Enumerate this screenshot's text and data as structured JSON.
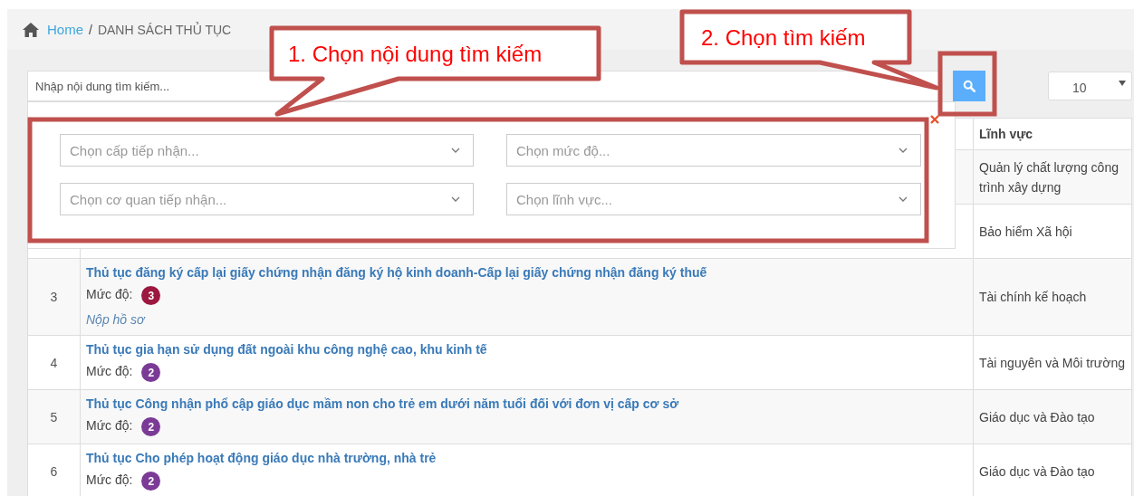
{
  "breadcrumb": {
    "home": "Home",
    "separator": "/",
    "current": "DANH SÁCH THỦ TỤC"
  },
  "search": {
    "placeholder": "Nhập nội dung tìm kiếm..."
  },
  "page_size": {
    "value": "10"
  },
  "filters": [
    {
      "placeholder": "Chọn cấp tiếp nhận..."
    },
    {
      "placeholder": "Chọn mức độ..."
    },
    {
      "placeholder": "Chọn cơ quan tiếp nhận..."
    },
    {
      "placeholder": "Chọn lĩnh vực..."
    }
  ],
  "table": {
    "columns": [
      {
        "label": "Lĩnh vực"
      }
    ],
    "rows": [
      {
        "field": "Quản lý chất lượng công trình xây dựng"
      },
      {
        "field": "Bảo hiểm Xã hội"
      },
      {
        "number": "3",
        "title": "Thủ tục đăng ký cấp lại giấy chứng nhận đăng ký hộ kinh doanh-Cấp lại giấy chứng nhận đăng ký thuế",
        "level_label": "Mức độ:",
        "level": "3",
        "color": "#9c1840",
        "action": "Nộp hồ sơ",
        "field": "Tài chính kế hoạch"
      },
      {
        "number": "4",
        "title": "Thủ tục gia hạn sử dụng đất ngoài khu công nghệ cao, khu kinh tế",
        "level_label": "Mức độ:",
        "level": "2",
        "color": "#7b3a96",
        "field": "Tài nguyên và Môi trường"
      },
      {
        "number": "5",
        "title": "Thủ tục Công nhận phổ cập giáo dục mầm non cho trẻ em dưới năm tuổi đối với đơn vị cấp cơ sở",
        "level_label": "Mức độ:",
        "level": "2",
        "color": "#7b3a96",
        "field": "Giáo dục và Đào tạo"
      },
      {
        "number": "6",
        "title": "Thủ tục Cho phép hoạt động giáo dục nhà trường, nhà trẻ",
        "level_label": "Mức độ:",
        "level": "2",
        "color": "#7b3a96",
        "field": "Giáo dục và Đào tạo"
      }
    ]
  },
  "callouts": [
    {
      "text": "1. Chọn nội dung tìm kiếm"
    },
    {
      "text": "2. Chọn tìm kiếm"
    }
  ]
}
